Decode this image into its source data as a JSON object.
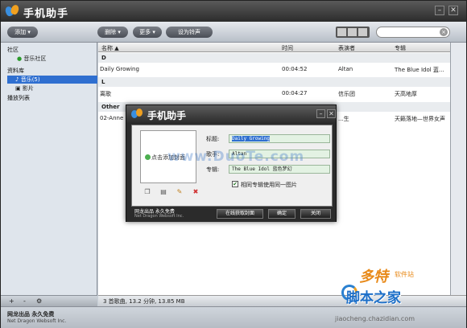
{
  "app": {
    "title": "手机助手"
  },
  "toolbar": {
    "add": "添加",
    "delete": "删除",
    "more": "更多",
    "set_ringtone": "设为铃声",
    "search_placeholder": ""
  },
  "sidebar": {
    "section_community": "社区",
    "music_community": "音乐社区",
    "section_library": "资料库",
    "music": "音乐(5)",
    "video": "影片",
    "section_playlist": "播放列表",
    "bottom_add": "+",
    "bottom_remove": "-",
    "bottom_gear": "⚙"
  },
  "list": {
    "columns": [
      "名称 ▲",
      "时间",
      "表演者",
      "专辑"
    ],
    "groups": [
      {
        "label": "D",
        "rows": [
          [
            "Daily Growing",
            "00:04:52",
            "Altan",
            "The Blue Idol 蓝..."
          ]
        ]
      },
      {
        "label": "L",
        "rows": [
          [
            "离歌",
            "00:04:27",
            "信乐团",
            "天高地厚"
          ]
        ]
      },
      {
        "label": "Other",
        "rows": [
          [
            "02-Anne Ka...",
            "",
            "...生",
            "天籁落地—世界女声"
          ]
        ]
      }
    ]
  },
  "status": {
    "text": "3 首歌曲, 13.2 分钟, 13.85 MB"
  },
  "footer": {
    "line1": "网龙出品 永久免费",
    "line2": "Net Dragon Websoft Inc."
  },
  "dialog": {
    "title": "手机助手",
    "cover_hint": "点击添加封面",
    "label_title": "标题:",
    "value_title": "Daily Growing",
    "label_artist": "歌手:",
    "value_artist": "Altan",
    "label_album": "专辑:",
    "value_album": "The Blue Idol 蓝色梦幻",
    "same_album_label": "相同专辑使用同一图片",
    "same_album_checked": true,
    "fetch_cover": "在线获取封面",
    "ok": "确定",
    "close": "关闭",
    "footer_line1": "网龙出品 永久免费",
    "footer_line2": "Net Dragon Websoft Inc."
  },
  "watermarks": {
    "center": "www.DuoTe.com",
    "brand1": "多特",
    "brand1_small": "软件站",
    "brand2": "脚本之家",
    "url": "jiaocheng.chazidian.com"
  },
  "colors": {
    "selection": "#2f6fd0",
    "input_bg": "#e3f2e3",
    "titlebar": "#2c2c2c"
  }
}
